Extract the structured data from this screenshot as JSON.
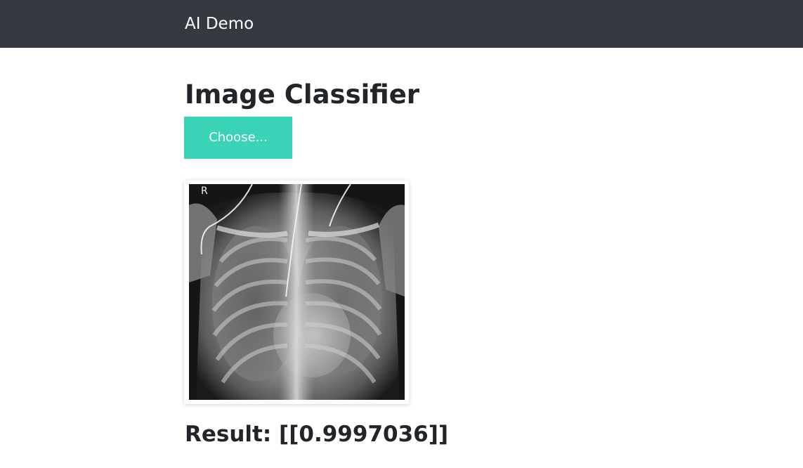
{
  "navbar": {
    "brand": "AI Demo",
    "background_color": "#343a40"
  },
  "main": {
    "title": "Image Classifier",
    "choose_button": {
      "label": "Choose...",
      "color": "#3bd3b5"
    },
    "preview": {
      "watermark_letter": "R"
    },
    "result": {
      "text": "Result: [[0.9997036]]"
    }
  }
}
